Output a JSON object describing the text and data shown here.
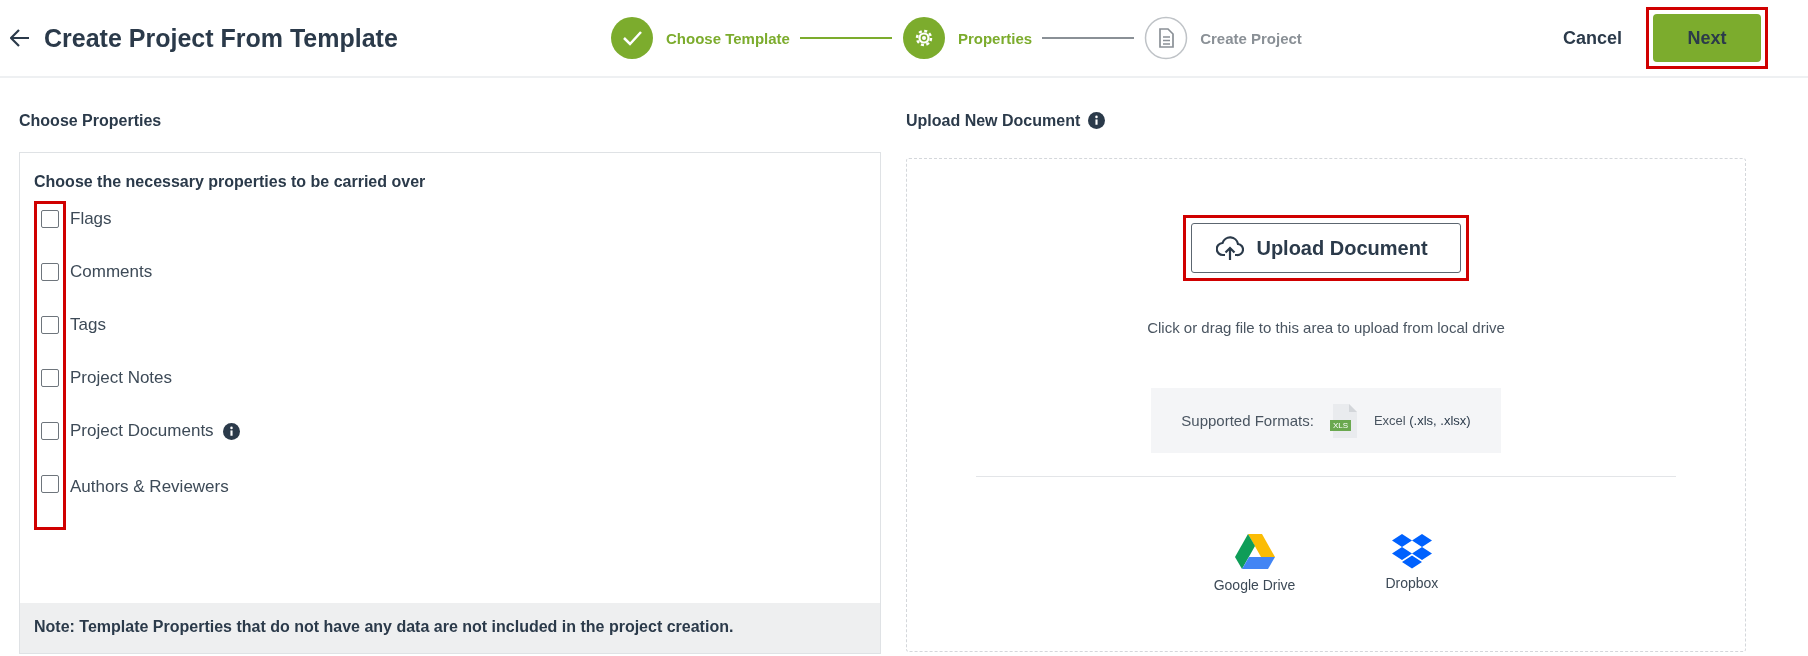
{
  "header": {
    "title": "Create Project From Template",
    "cancel": "Cancel",
    "next": {
      "label": "Next",
      "highlighted": true
    }
  },
  "steps": [
    {
      "label": "Choose Template",
      "kind": "done"
    },
    {
      "label": "Properties",
      "kind": "current"
    },
    {
      "label": "Create Project",
      "kind": "pending"
    }
  ],
  "properties": {
    "heading": "Choose Properties",
    "instruction": "Choose the necessary properties to be carried over",
    "checkboxes_highlighted": true,
    "items": [
      {
        "label": "Flags",
        "checked": false,
        "info": false
      },
      {
        "label": "Comments",
        "checked": false,
        "info": false
      },
      {
        "label": "Tags",
        "checked": false,
        "info": false
      },
      {
        "label": "Project Notes",
        "checked": false,
        "info": false
      },
      {
        "label": "Project Documents",
        "checked": false,
        "info": true
      },
      {
        "label": "Authors & Reviewers",
        "checked": false,
        "info": false
      }
    ],
    "note": "Note: Template Properties that do not have any data are not included in the project creation."
  },
  "upload": {
    "heading": "Upload New Document",
    "button": {
      "label": "Upload Document",
      "highlighted": true
    },
    "hint": "Click or drag file to this area to upload from local drive",
    "formats_label": "Supported Formats:",
    "file_badge": "XLS",
    "format_name": "Excel ",
    "format_ext": "(.xls, .xlsx)",
    "sources": [
      {
        "label": "Google Drive",
        "kind": "gdrive"
      },
      {
        "label": "Dropbox",
        "kind": "dropbox"
      }
    ]
  }
}
